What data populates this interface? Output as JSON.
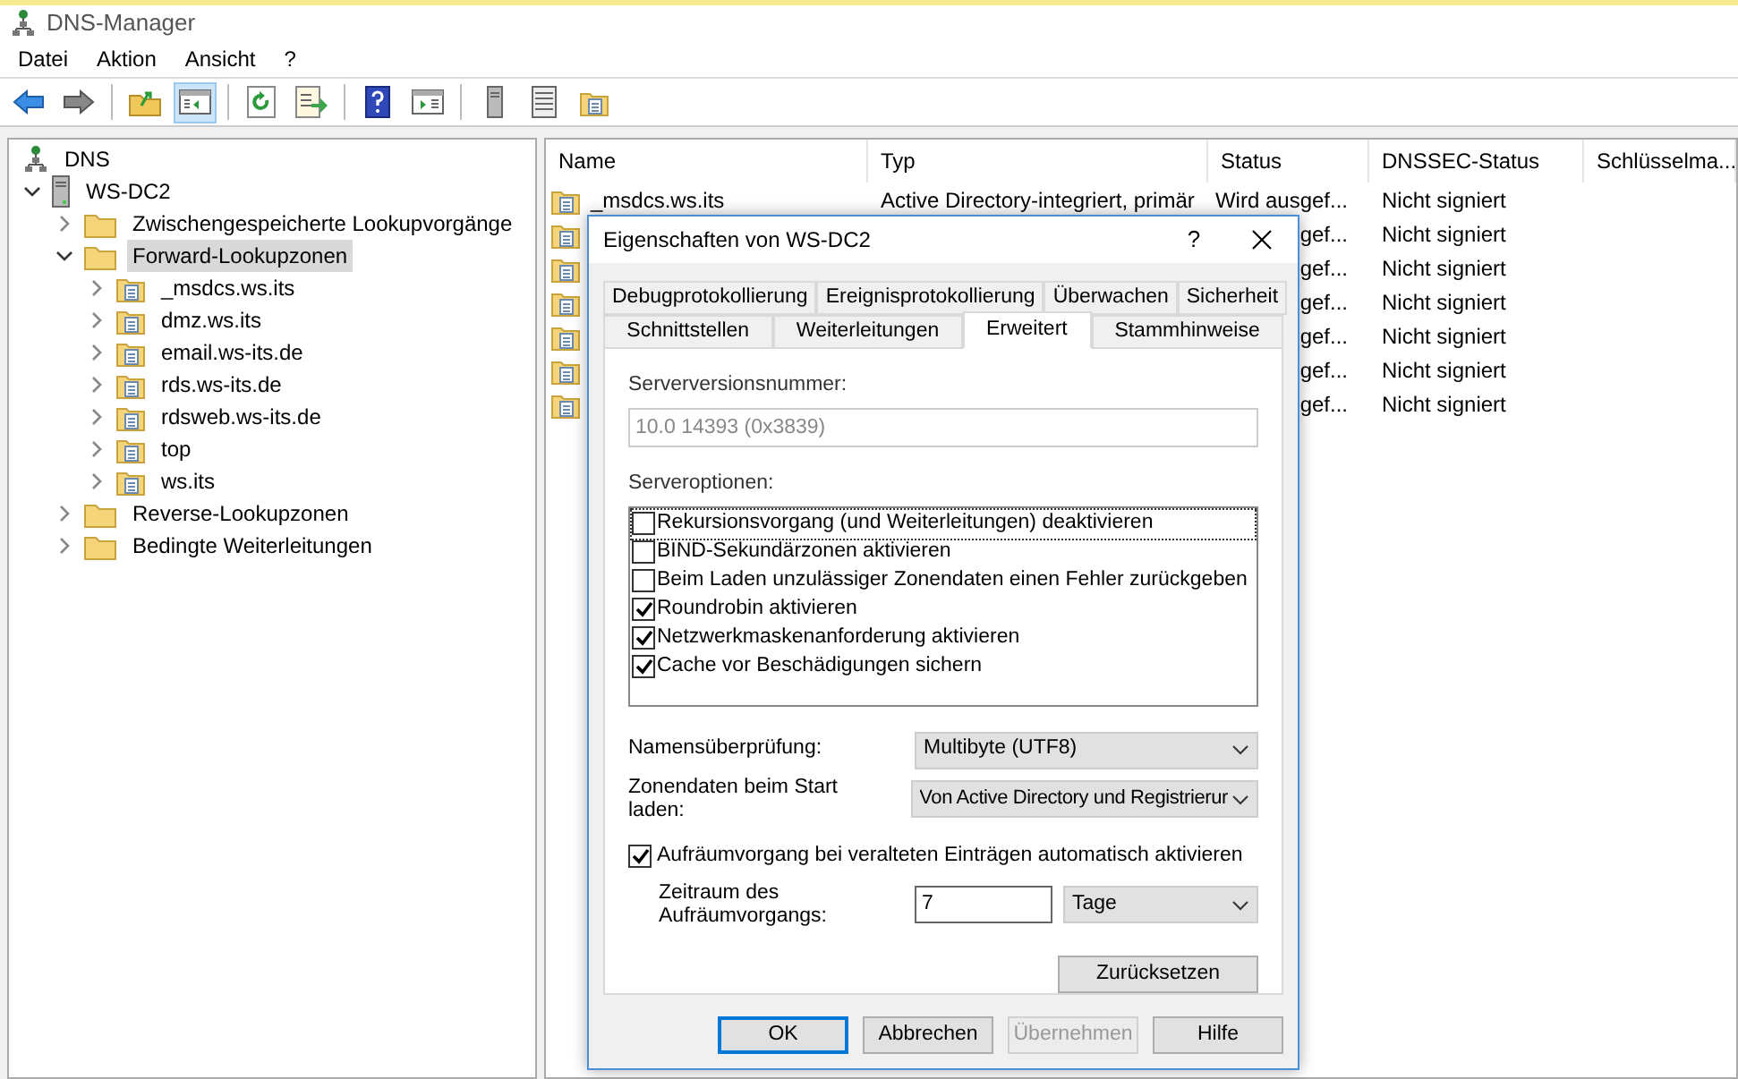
{
  "window": {
    "title": "DNS-Manager"
  },
  "menu": [
    "Datei",
    "Aktion",
    "Ansicht",
    "?"
  ],
  "toolbar": [
    {
      "kind": "back",
      "pressed": false
    },
    {
      "kind": "forward",
      "pressed": false
    },
    {
      "kind": "sep"
    },
    {
      "kind": "up",
      "pressed": false
    },
    {
      "kind": "tree",
      "pressed": true
    },
    {
      "kind": "sep"
    },
    {
      "kind": "refresh",
      "pressed": false
    },
    {
      "kind": "export",
      "pressed": false
    },
    {
      "kind": "sep"
    },
    {
      "kind": "help",
      "pressed": false
    },
    {
      "kind": "action",
      "pressed": false
    },
    {
      "kind": "sep"
    },
    {
      "kind": "server",
      "pressed": false
    },
    {
      "kind": "list",
      "pressed": false
    },
    {
      "kind": "zone",
      "pressed": false
    }
  ],
  "tree": [
    {
      "label": "DNS",
      "kind": "root",
      "expanded": true,
      "selected": false,
      "children": [
        {
          "label": "WS-DC2",
          "kind": "server",
          "expanded": true,
          "selected": false,
          "children": [
            {
              "label": "Zwischengespeicherte Lookupvorgänge",
              "kind": "folder",
              "expanded": false,
              "selected": false
            },
            {
              "label": "Forward-Lookupzonen",
              "kind": "folder",
              "expanded": true,
              "selected": true,
              "children": [
                {
                  "label": "_msdcs.ws.its",
                  "kind": "zone",
                  "expanded": false,
                  "selected": false
                },
                {
                  "label": "dmz.ws.its",
                  "kind": "zone",
                  "expanded": false,
                  "selected": false
                },
                {
                  "label": "email.ws-its.de",
                  "kind": "zone",
                  "expanded": false,
                  "selected": false
                },
                {
                  "label": "rds.ws-its.de",
                  "kind": "zone",
                  "expanded": false,
                  "selected": false
                },
                {
                  "label": "rdsweb.ws-its.de",
                  "kind": "zone",
                  "expanded": false,
                  "selected": false
                },
                {
                  "label": "top",
                  "kind": "zone",
                  "expanded": false,
                  "selected": false
                },
                {
                  "label": "ws.its",
                  "kind": "zone",
                  "expanded": false,
                  "selected": false
                }
              ]
            },
            {
              "label": "Reverse-Lookupzonen",
              "kind": "folder",
              "expanded": false,
              "selected": false
            },
            {
              "label": "Bedingte Weiterleitungen",
              "kind": "folder",
              "expanded": false,
              "selected": false
            }
          ]
        }
      ]
    }
  ],
  "table": {
    "columns": [
      "Name",
      "Typ",
      "Status",
      "DNSSEC-Status",
      "Schlüsselma..."
    ],
    "rows": [
      {
        "name": "_msdcs.ws.its",
        "type": "Active Directory-integriert, primär",
        "status": "Wird ausgef...",
        "dnssec": "Nicht signiert"
      },
      {
        "status": "gef...",
        "dnssec": "Nicht signiert"
      },
      {
        "status": "gef...",
        "dnssec": "Nicht signiert"
      },
      {
        "status": "gef...",
        "dnssec": "Nicht signiert"
      },
      {
        "status": "gef...",
        "dnssec": "Nicht signiert"
      },
      {
        "status": "gef...",
        "dnssec": "Nicht signiert"
      },
      {
        "status": "gef...",
        "dnssec": "Nicht signiert"
      }
    ]
  },
  "dialog": {
    "title": "Eigenschaften von WS-DC2",
    "help": "?",
    "tab_rows": [
      [
        {
          "label": "Debugprotokollierung",
          "selected": false
        },
        {
          "label": "Ereignisprotokollierung",
          "selected": false
        },
        {
          "label": "Überwachen",
          "selected": false
        },
        {
          "label": "Sicherheit",
          "selected": false
        }
      ],
      [
        {
          "label": "Schnittstellen",
          "selected": false
        },
        {
          "label": "Weiterleitungen",
          "selected": false
        },
        {
          "label": "Erweitert",
          "selected": true
        },
        {
          "label": "Stammhinweise",
          "selected": false
        }
      ]
    ],
    "version_label": "Serverversionsnummer:",
    "version_value": "10.0 14393 (0x3839)",
    "options_label": "Serveroptionen:",
    "options": [
      {
        "label": "Rekursionsvorgang (und Weiterleitungen) deaktivieren",
        "checked": false,
        "focused": true
      },
      {
        "label": "BIND-Sekundärzonen aktivieren",
        "checked": false,
        "focused": false
      },
      {
        "label": "Beim Laden unzulässiger Zonendaten einen Fehler zurückgeben",
        "checked": false,
        "focused": false
      },
      {
        "label": "Roundrobin aktivieren",
        "checked": true,
        "focused": false
      },
      {
        "label": "Netzwerkmaskenanforderung aktivieren",
        "checked": true,
        "focused": false
      },
      {
        "label": "Cache vor Beschädigungen sichern",
        "checked": true,
        "focused": false
      }
    ],
    "name_check": {
      "label": "Namensüberprüfung:",
      "value": "Multibyte (UTF8)"
    },
    "load_zone": {
      "label": "Zonendaten beim Start laden:",
      "value": "Von Active Directory und Registrierur"
    },
    "scavenging": {
      "label": "Aufräumvorgang bei veralteten Einträgen automatisch aktivieren",
      "checked": true
    },
    "period": {
      "label": "Zeitraum des Aufräumvorgangs:",
      "value": "7",
      "unit": "Tage"
    },
    "reset": "Zurücksetzen",
    "buttons": [
      {
        "label": "OK",
        "default": true,
        "disabled": false
      },
      {
        "label": "Abbrechen",
        "default": false,
        "disabled": false
      },
      {
        "label": "Übernehmen",
        "default": false,
        "disabled": true
      },
      {
        "label": "Hilfe",
        "default": false,
        "disabled": false
      }
    ]
  }
}
